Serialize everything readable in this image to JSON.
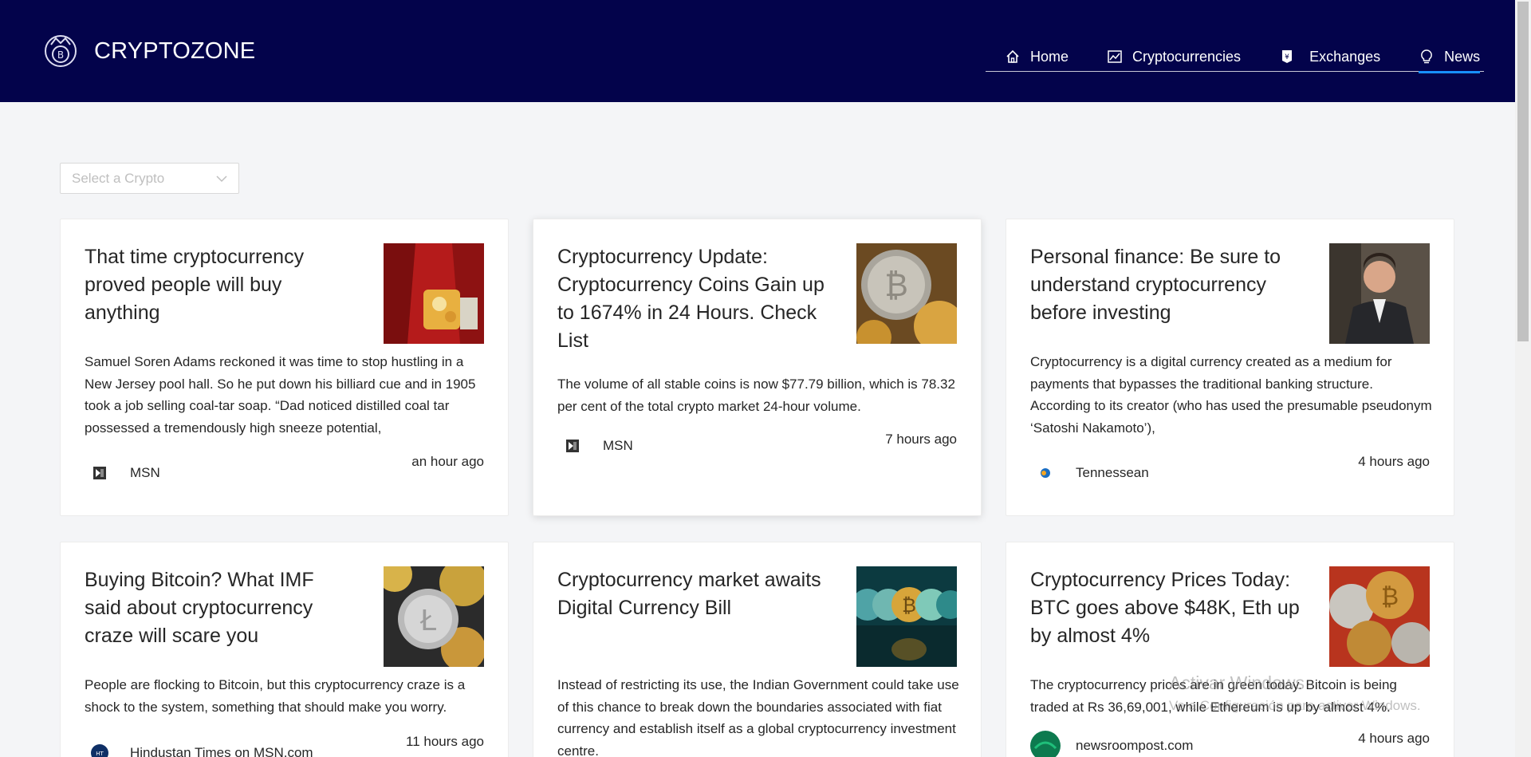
{
  "header": {
    "brand": "CRYPTOZONE",
    "nav": [
      {
        "label": "Home",
        "icon": "home-icon"
      },
      {
        "label": "Cryptocurrencies",
        "icon": "line-chart-icon"
      },
      {
        "label": "Exchanges",
        "icon": "money-collect-icon"
      },
      {
        "label": "News",
        "icon": "bulb-icon",
        "active": true
      }
    ]
  },
  "filter": {
    "placeholder": "Select a Crypto"
  },
  "cards": [
    {
      "title": "That time cryptocurrency proved people will buy anything",
      "description": "Samuel Soren Adams reckoned it was time to stop hustling in a New Jersey pool hall. So he put down his billiard cue and in 1905 took a job selling coal-tar soap. “Dad noticed distilled coal tar possessed a tremendously high sneeze potential,",
      "provider": "MSN",
      "time": "an hour ago"
    },
    {
      "title": "Cryptocurrency Update: Cryptocurrency Coins Gain up to 1674% in 24 Hours. Check List",
      "description": "The volume of all stable coins is now $77.79 billion, which is 78.32 per cent of the total crypto market 24-hour volume.",
      "provider": "MSN",
      "time": "7 hours ago"
    },
    {
      "title": "Personal finance: Be sure to understand cryptocurrency before investing",
      "description": "Cryptocurrency is a digital currency created as a medium for payments that bypasses the traditional banking structure. According to its creator (who has used the presumable pseudonym ‘Satoshi Nakamoto’),",
      "provider": "Tennessean",
      "time": "4 hours ago"
    },
    {
      "title": "Buying Bitcoin? What IMF said about cryptocurrency craze will scare you",
      "description": "People are flocking to Bitcoin, but this cryptocurrency craze is a shock to the system, something that should make you worry.",
      "provider": "Hindustan Times on MSN.com",
      "time": "11 hours ago"
    },
    {
      "title": "Cryptocurrency market awaits Digital Currency Bill",
      "description": "Instead of restricting its use, the Indian Government could take use of this chance to break down the boundaries associated with fiat currency and establish itself as a global cryptocurrency investment centre.",
      "provider": "",
      "time": ""
    },
    {
      "title": "Cryptocurrency Prices Today: BTC goes above $48K, Eth up by almost 4%",
      "description": "The cryptocurrency prices are in green today. Bitcoin is being traded at Rs 36,69,001, while Ethereum is up by almost 4%.",
      "provider": "newsroompost.com",
      "time": "4 hours ago"
    }
  ],
  "overlay": {
    "watermark_title": "Activar Windows",
    "watermark_sub": "Ve a Configuración para activar Windows."
  }
}
